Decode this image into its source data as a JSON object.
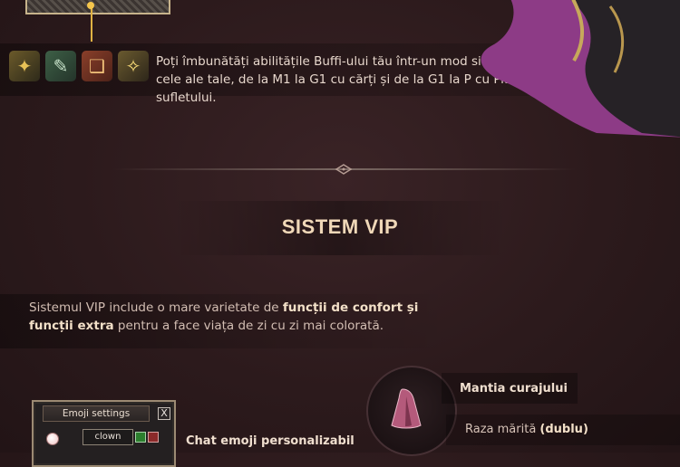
{
  "buff": {
    "icons": [
      "buff-skill-icon-1",
      "buff-skill-icon-2",
      "buff-skill-icon-3",
      "buff-skill-icon-4"
    ],
    "text": "Poți îmbunătăți abilitățile Buffi-ului tău într-un mod similar cu cele ale tale, de la M1 la G1 cu cărți și de la G1 la P cu Piatra sufletului."
  },
  "vip": {
    "title": "SISTEM VIP",
    "intro_before": "Sistemul VIP include o mare varietate de ",
    "intro_bold1": "funcții de confort și funcții extra",
    "intro_after": " pentru a face viața de zi cu zi mai colorată."
  },
  "emoji_settings": {
    "title": "Emoji settings",
    "field_value": "clown",
    "close_symbol": "X",
    "label": "Chat emoji personalizabil"
  },
  "mantle": {
    "label": "Mantia curajului",
    "stat_before": "Raza mărită ",
    "stat_bold": "(dublu)"
  },
  "colors": {
    "background": "#2c1a1c",
    "accent": "#f0d8b8"
  }
}
